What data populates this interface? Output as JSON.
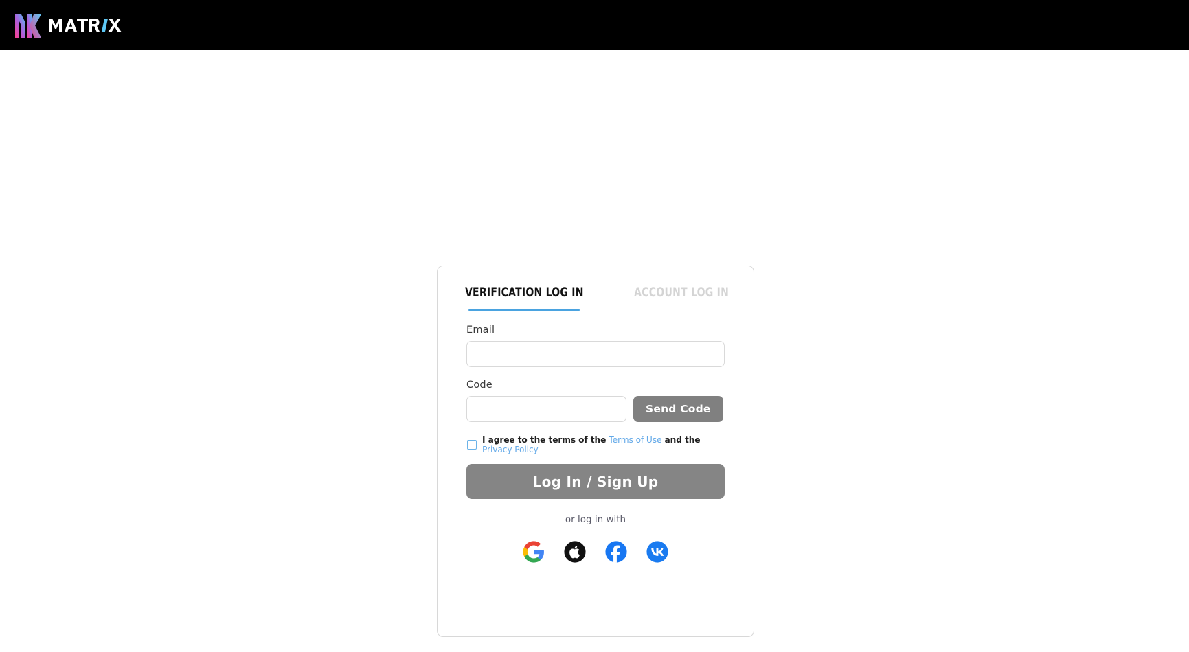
{
  "header": {
    "brand_mark_icon": "mk-monogram-icon",
    "brand_name": "MATRIX",
    "background_color": "#000000",
    "gradient_from": "#ff4d9d",
    "gradient_to": "#4fc3f7"
  },
  "card": {
    "tabs": [
      {
        "label": "VERIFICATION LOG IN",
        "active": true
      },
      {
        "label": "ACCOUNT LOG IN",
        "active": false
      }
    ],
    "active_tab_underline_color": "#4aa3e0",
    "inactive_tab_color": "#d4d4d4",
    "fields": {
      "email": {
        "label": "Email",
        "value": "",
        "placeholder": ""
      },
      "code": {
        "label": "Code",
        "value": "",
        "placeholder": ""
      }
    },
    "send_code_label": "Send Code",
    "send_code_color": "#808080",
    "agreement": {
      "checked": false,
      "text_before": "I agree to the terms of the",
      "terms_link": "Terms of Use",
      "text_middle": "and the",
      "privacy_link": "Privacy Policy",
      "link_color": "#63a9e8",
      "checkbox_border_color": "#6cb3e8"
    },
    "submit_label": "Log In / Sign Up",
    "submit_color": "#858585",
    "divider_label": "or log in with",
    "social": [
      {
        "name": "google",
        "icon": "google-icon"
      },
      {
        "name": "apple",
        "icon": "apple-icon"
      },
      {
        "name": "facebook",
        "icon": "facebook-icon"
      },
      {
        "name": "vk",
        "icon": "vk-icon"
      }
    ]
  }
}
